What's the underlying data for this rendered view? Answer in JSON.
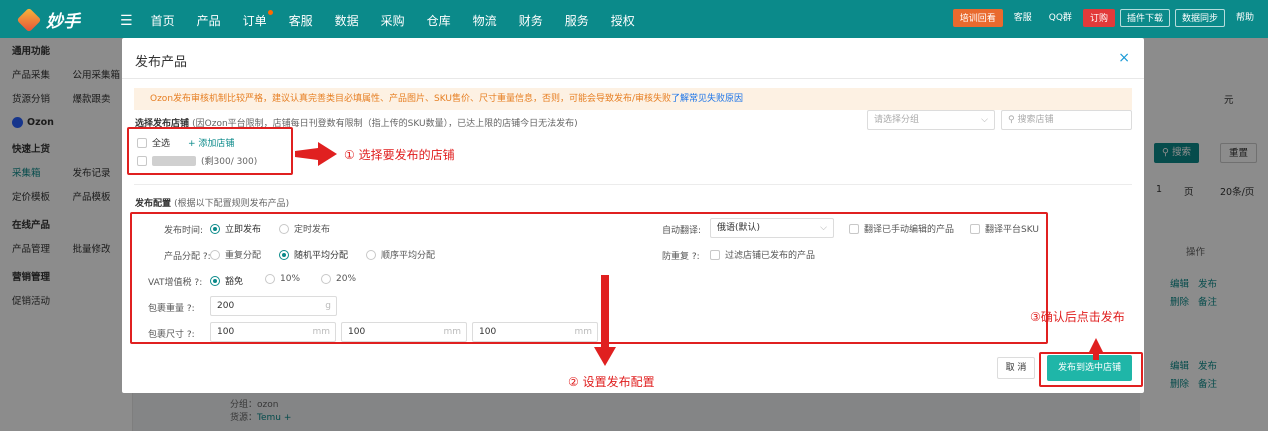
{
  "topnav": {
    "logo_text": "妙手",
    "menu": [
      "首页",
      "产品",
      "订单",
      "客服",
      "数据",
      "采购",
      "仓库",
      "物流",
      "财务",
      "服务",
      "授权"
    ],
    "right": [
      "培训回看",
      "客服",
      "QQ群",
      "订购",
      "插件下载",
      "数据同步",
      "帮助"
    ]
  },
  "sidebar": {
    "rows": [
      [
        "通用功能",
        ""
      ],
      [
        "产品采集",
        "公用采集箱"
      ],
      [
        "货源分销",
        "爆款跟卖"
      ],
      [
        "Ozon",
        ""
      ],
      [
        "快速上货",
        ""
      ],
      [
        "采集箱",
        "发布记录"
      ],
      [
        "定价模板",
        "产品模板"
      ],
      [
        "在线产品",
        ""
      ],
      [
        "产品管理",
        "批量修改"
      ],
      [
        "营销管理",
        ""
      ],
      [
        "促销活动",
        ""
      ]
    ]
  },
  "background": {
    "unit_yuan": "元",
    "search_btn": "搜索",
    "reset_btn": "重置",
    "pager_page": "1",
    "pager_page_label": "页",
    "pager_size": "20条/页",
    "col_action": "操作",
    "action_edit": "编辑",
    "action_publish": "发布",
    "action_delete": "删除",
    "action_note": "备注",
    "group_label": "分组：ozon",
    "source_label": "货源：",
    "source_value": "Temu",
    "source_add": "+"
  },
  "modal": {
    "title": "发布产品",
    "close": "×",
    "warning": "Ozon发布审核机制比较严格，建议认真完善类目必填属性、产品图片、SKU售价、尺寸重量信息，否则，可能会导致发布/审核失败",
    "warning_link": "了解常见失败原因",
    "shop_section_title": "选择发布店铺",
    "shop_section_note": "(因Ozon平台限制，店铺每日刊登数有限制（指上传的SKU数量），已达上限的店铺今日无法发布)",
    "group_select_placeholder": "请选择分组",
    "shop_search_placeholder": "搜索店铺",
    "select_all": "全选",
    "add_shop": "+ 添加店铺",
    "shop_quota": "(剩300/ 300)",
    "config_section_title": "发布配置",
    "config_section_note": "(根据以下配置规则发布产品)",
    "publish_time_label": "发布时间:",
    "publish_now": "立即发布",
    "publish_scheduled": "定时发布",
    "auto_translate_label": "自动翻译:",
    "auto_translate_value": "俄语(默认)",
    "translate_edited": "翻译已手动编辑的产品",
    "translate_sku": "翻译平台SKU",
    "product_assign_label": "产品分配",
    "assign_repeat": "重复分配",
    "assign_random": "随机平均分配",
    "assign_order": "顺序平均分配",
    "dedupe_label": "防重复",
    "dedupe_option": "过滤店铺已发布的产品",
    "vat_label": "VAT增值税",
    "vat_exempt": "豁免",
    "vat_10": "10%",
    "vat_20": "20%",
    "weight_label": "包裹重量",
    "weight_value": "200",
    "weight_unit": "g",
    "size_label": "包裹尺寸",
    "size_values": [
      "100",
      "100",
      "100"
    ],
    "size_unit": "mm",
    "cancel": "取 消",
    "publish_btn": "发布到选中店铺"
  },
  "annotations": {
    "step1": "① 选择要发布的店铺",
    "step2": "② 设置发布配置",
    "step3": "③确认后点击发布"
  },
  "colors": {
    "brand": "#0b8a8a",
    "publish": "#1fb6a8",
    "annotation": "#e02020",
    "warning_bg": "#fdf1e3"
  }
}
